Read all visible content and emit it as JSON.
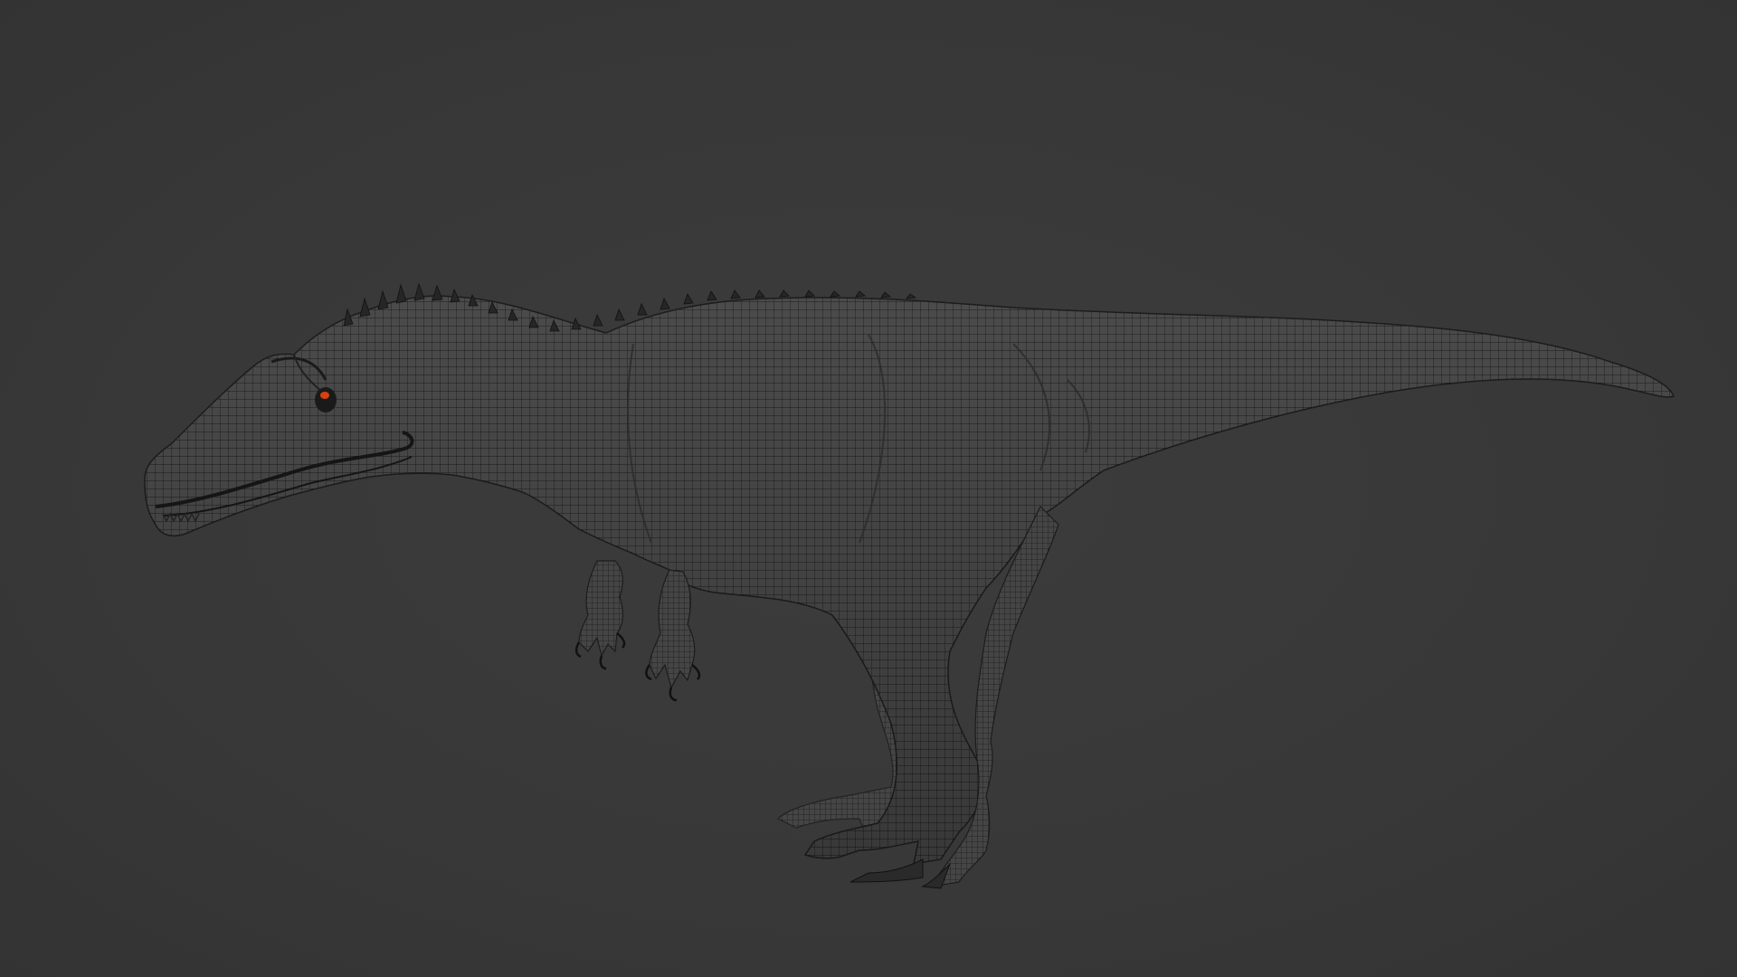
{
  "viewport": {
    "background_color": "#3a3a3a",
    "mesh_fill_color": "#4a4a4a",
    "mesh_wire_color": "#1a1a1a",
    "eye_color": "#d9400f"
  },
  "model": {
    "subject": "theropod-dinosaur-wireframe-mesh"
  }
}
